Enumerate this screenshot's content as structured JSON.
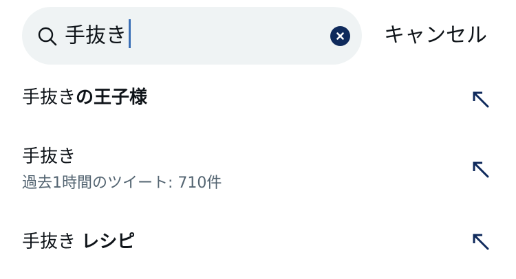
{
  "search": {
    "value": "手抜き",
    "clear_icon": "close-circle-icon",
    "search_icon": "search-icon",
    "accent": "#0f2a5c"
  },
  "cancel_label": "キャンセル",
  "suggestions": [
    {
      "prefix": "手抜き",
      "bold": "の王子様",
      "sub": "",
      "icon": "arrow-up-left-icon"
    },
    {
      "prefix": "手抜き",
      "bold": "",
      "sub": "過去1時間のツイート: 710件",
      "icon": "arrow-up-left-icon"
    },
    {
      "prefix": "手抜き ",
      "bold": "レシピ",
      "sub": "",
      "icon": "arrow-up-left-icon"
    }
  ]
}
